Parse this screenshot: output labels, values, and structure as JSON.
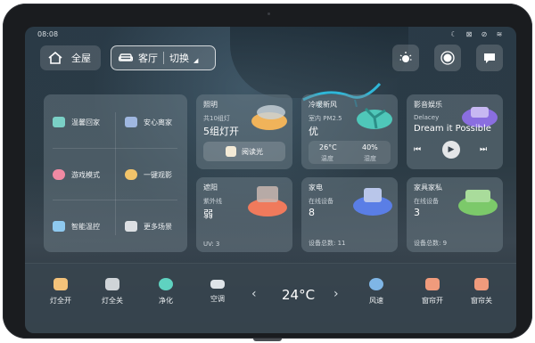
{
  "status_bar": {
    "time": "08:08",
    "icons": [
      "moon-icon",
      "no-signal-icon",
      "mute-icon",
      "wifi-icon"
    ]
  },
  "header": {
    "home_label": "全屋",
    "room_label": "客厅",
    "switch_label": "切换",
    "right_buttons": [
      "light-bulb-icon",
      "record-icon",
      "message-icon"
    ]
  },
  "scenes": [
    {
      "label": "温馨回家",
      "icon": "home-icon",
      "color": "#7ad0c6"
    },
    {
      "label": "安心离家",
      "icon": "home-icon",
      "color": "#9fb7e0"
    },
    {
      "label": "游戏模式",
      "icon": "gamepad-icon",
      "color": "#f08aa3"
    },
    {
      "label": "一键观影",
      "icon": "film-icon",
      "color": "#f2c46a"
    },
    {
      "label": "智能温控",
      "icon": "thermostat-icon",
      "color": "#8ec9ef"
    },
    {
      "label": "更多场景",
      "icon": "more-icon",
      "color": "#dcdfe3"
    }
  ],
  "cards": {
    "lighting": {
      "title": "照明",
      "sub": "共10组灯",
      "value": "5组灯开",
      "button": "阅读光",
      "color": "#f0b35a"
    },
    "ventilation": {
      "title": "冷暖新风",
      "sub": "室内 PM2.5",
      "value": "优",
      "temp": "26°C",
      "temp_label": "温度",
      "humidity": "40%",
      "humidity_label": "湿度",
      "color": "#4fc7b9"
    },
    "media": {
      "title": "影音娱乐",
      "artist": "Delacey",
      "song": "Dream it Possible",
      "color": "#8a6ee0"
    },
    "shade": {
      "title": "遮阳",
      "sub": "紫外线",
      "value": "弱",
      "foot": "UV: 3",
      "color": "#f07a5c"
    },
    "appliance": {
      "title": "家电",
      "sub": "在线设备",
      "value": "8",
      "foot": "设备总数: 11",
      "color": "#5a7ee6"
    },
    "furniture": {
      "title": "家具家私",
      "sub": "在线设备",
      "value": "3",
      "foot": "设备总数: 9",
      "color": "#7cc96a"
    }
  },
  "bottom_bar": {
    "items": [
      {
        "label": "灯全开",
        "icon": "lamp-on-icon",
        "color": "#f3c27a"
      },
      {
        "label": "灯全关",
        "icon": "lamp-off-icon",
        "color": "#cfd4d8"
      },
      {
        "label": "净化",
        "icon": "purify-icon",
        "color": "#5fd2c0"
      },
      {
        "label": "空调",
        "icon": "air-conditioner-icon",
        "color": "#dfe4e8"
      },
      {
        "label": "风速",
        "icon": "fan-icon",
        "color": "#7fb6e6"
      },
      {
        "label": "窗帘开",
        "icon": "curtain-open-icon",
        "color": "#f09b7c"
      },
      {
        "label": "窗帘关",
        "icon": "curtain-close-icon",
        "color": "#f09b7c"
      }
    ],
    "temperature": "24°C",
    "prev": "‹",
    "next": "›"
  }
}
